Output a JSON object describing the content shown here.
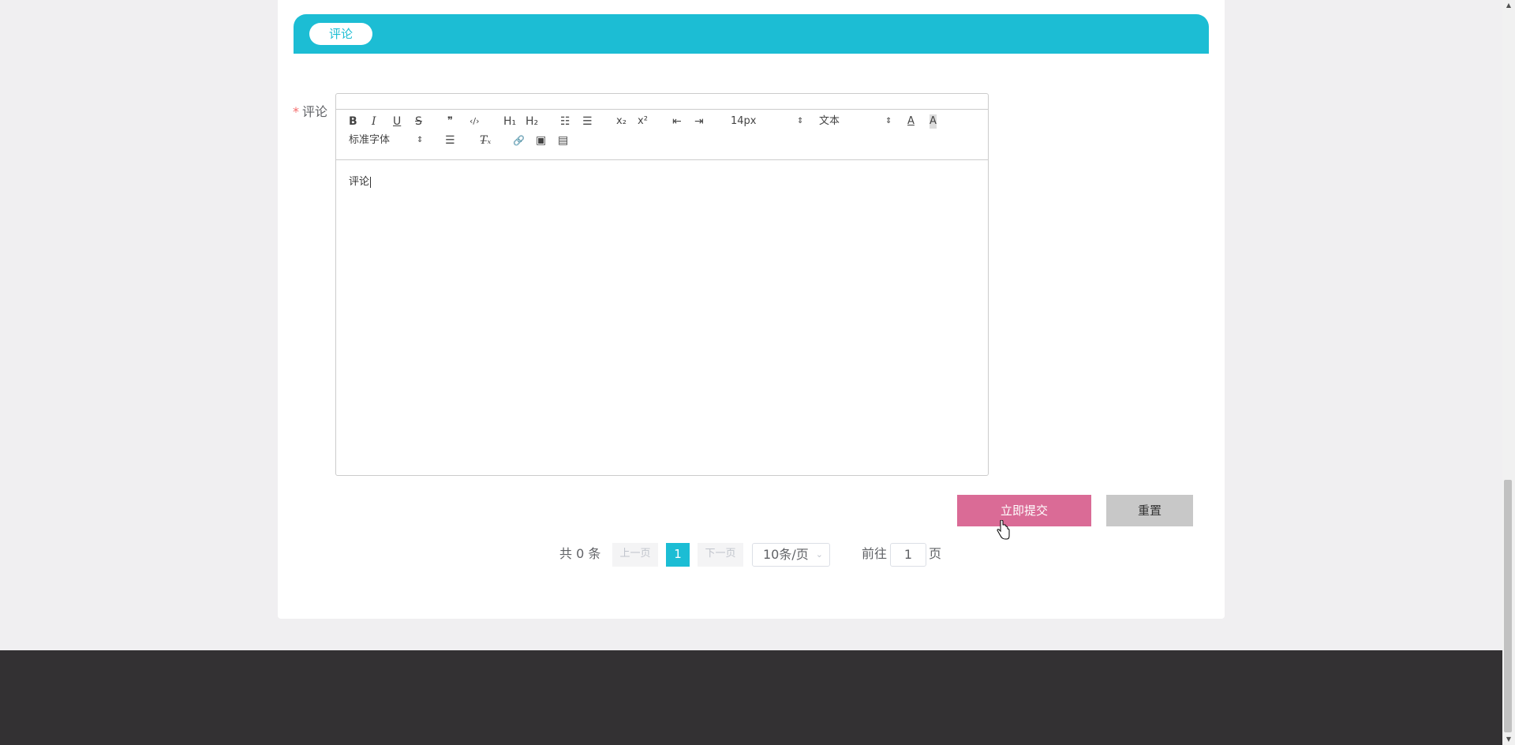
{
  "section": {
    "tab_label": "评论"
  },
  "form": {
    "comment_label": "评论",
    "required_mark": "*",
    "editor": {
      "toolbar": {
        "bold": "B",
        "italic": "I",
        "underline": "U",
        "strike": "S",
        "blockquote": "❞",
        "code": "‹/›",
        "h1": "H₁",
        "h2": "H₂",
        "ordered_list": "☷",
        "bullet_list": "☰",
        "subscript": "x₂",
        "superscript": "x²",
        "outdent": "⇤",
        "indent": "⇥",
        "size_select": "14px",
        "header_select": "文本",
        "font_color": "A",
        "background_color": "A",
        "font_select": "标准字体",
        "align": "☰",
        "clean": "T̶ₓ",
        "link": "🔗",
        "image": "▣",
        "video": "▤"
      },
      "content": "评论"
    },
    "submit_label": "立即提交",
    "reset_label": "重置"
  },
  "pagination": {
    "total_text": "共 0 条",
    "prev_label": "上一页",
    "current_page": "1",
    "next_label": "下一页",
    "page_size": "10条/页",
    "goto_label": "前往",
    "goto_value": "1",
    "goto_unit": "页"
  },
  "colors": {
    "accent": "#1cbdd4",
    "submit": "#da6b96",
    "reset": "#c8c8c8",
    "footer": "#333133"
  }
}
